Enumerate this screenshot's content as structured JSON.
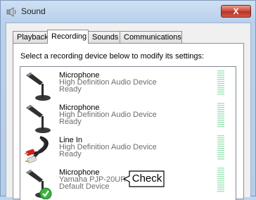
{
  "window": {
    "title": "Sound",
    "close_label": "X"
  },
  "tabs": [
    {
      "label": "Playback",
      "active": false
    },
    {
      "label": "Recording",
      "active": true
    },
    {
      "label": "Sounds",
      "active": false
    },
    {
      "label": "Communications",
      "active": false
    }
  ],
  "instruction": "Select a recording device below to modify its settings:",
  "devices": [
    {
      "name": "Microphone",
      "description": "High Definition Audio Device",
      "status": "Ready",
      "icon": "microphone-icon"
    },
    {
      "name": "Microphone",
      "description": "High Definition Audio Device",
      "status": "Ready",
      "icon": "microphone-icon"
    },
    {
      "name": "Line In",
      "description": "High Definition Audio Device",
      "status": "Ready",
      "icon": "line-in-cable-icon"
    },
    {
      "name": "Microphone",
      "description": "Yamaha PJP-20UR",
      "status": "Default Device",
      "icon": "microphone-default-icon"
    }
  ],
  "callout": {
    "text": "Check"
  },
  "colors": {
    "meter_green": "#9fe4b8",
    "default_check": "#3cb43c",
    "desc_text": "#6d6d6d"
  }
}
